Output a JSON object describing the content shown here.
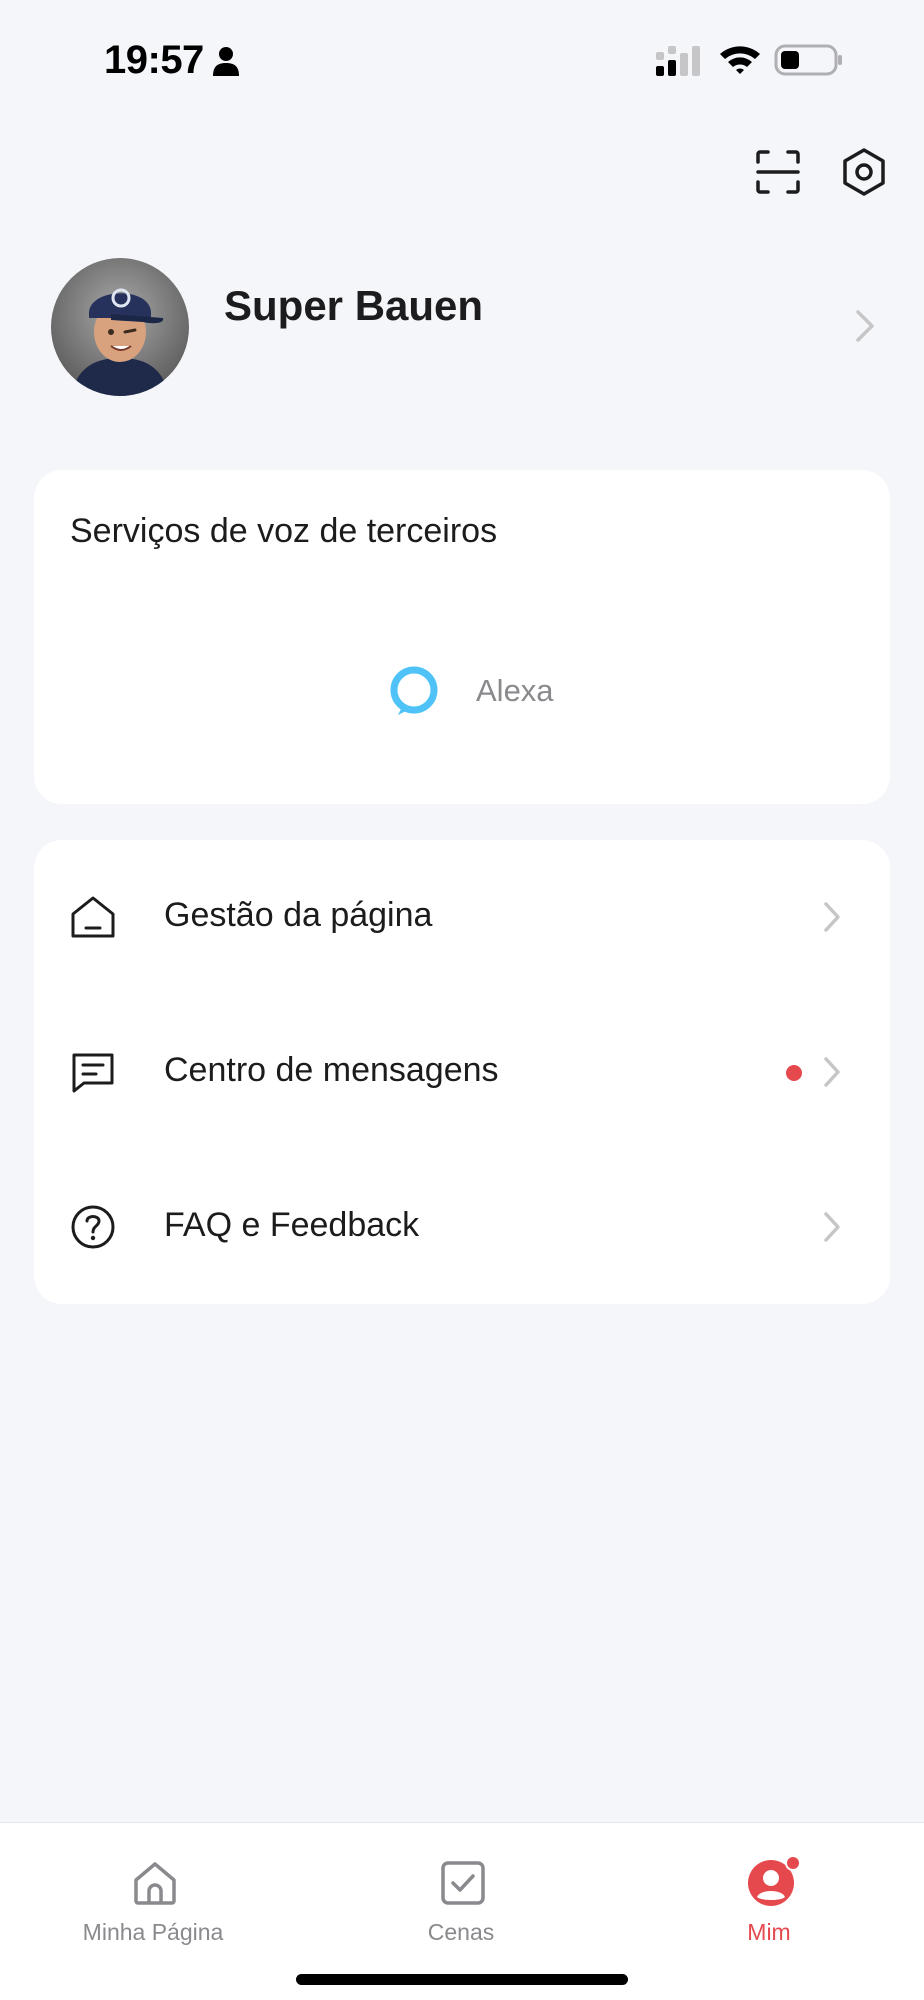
{
  "status_bar": {
    "time": "19:57",
    "icons": [
      "person-icon",
      "signal-icon",
      "wifi-icon",
      "battery-icon"
    ]
  },
  "header": {
    "actions": [
      "scan-icon",
      "settings-icon"
    ]
  },
  "profile": {
    "name": "Super Bauen",
    "avatar_icon": "avatar"
  },
  "voice_services": {
    "title": "Serviços de voz de terceiros",
    "items": [
      {
        "label": "Alexa",
        "icon": "alexa-logo-icon",
        "color": "#4fc3f7"
      }
    ]
  },
  "menu": {
    "items": [
      {
        "label": "Gestão da página",
        "icon": "home-outline-icon",
        "has_badge": false
      },
      {
        "label": "Centro de mensagens",
        "icon": "message-icon",
        "has_badge": true
      },
      {
        "label": "FAQ e Feedback",
        "icon": "help-circle-icon",
        "has_badge": false
      }
    ]
  },
  "tab_bar": {
    "tabs": [
      {
        "label": "Minha Página",
        "icon": "home-icon",
        "active": false
      },
      {
        "label": "Cenas",
        "icon": "check-square-icon",
        "active": false
      },
      {
        "label": "Mim",
        "icon": "user-circle-icon",
        "active": true,
        "has_badge": true
      }
    ]
  },
  "colors": {
    "background": "#f5f6fa",
    "card": "#ffffff",
    "accent": "#e5484d",
    "alexa": "#4fc3f7",
    "secondary_text": "#8a8a8e"
  }
}
